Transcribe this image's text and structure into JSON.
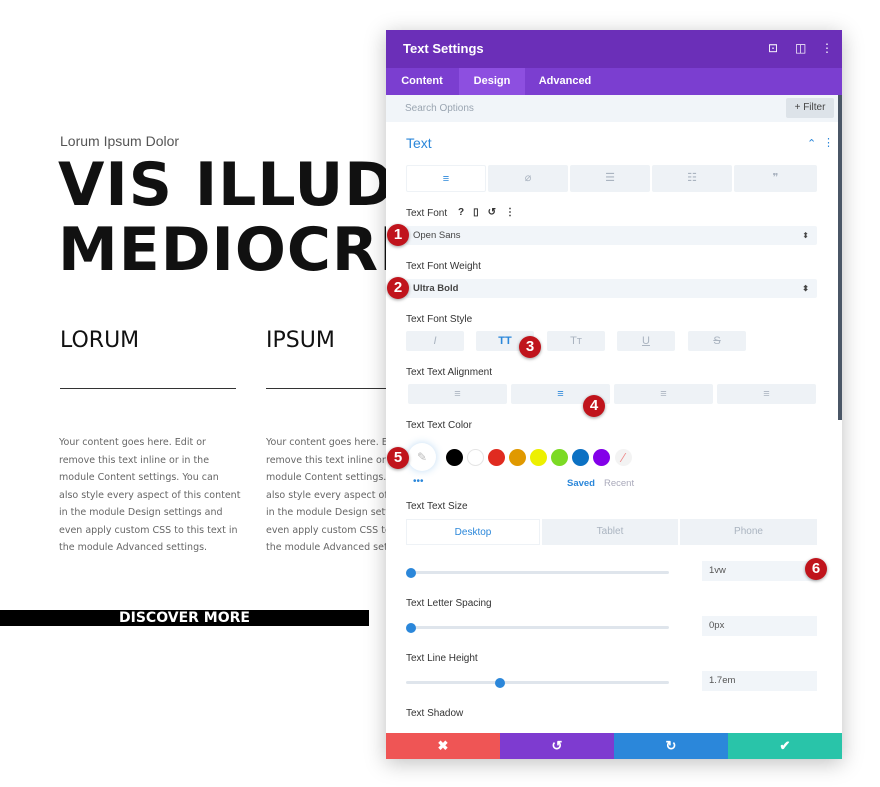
{
  "page": {
    "subtitle": "Lorum Ipsum Dolor",
    "heading_lines": [
      "VIS ILLUD EX",
      "MEDIOCRITA"
    ],
    "columns": [
      {
        "title": "LORUM",
        "body": "Your content goes here. Edit or remove this text inline or in the module Content settings. You can also style every aspect of this content in the module Design settings and even apply custom CSS to this text in the module Advanced settings."
      },
      {
        "title": "IPSUM",
        "body": "Your content goes here. Edit or remove this text inline or in the module Content settings. You can also style every aspect of this content in the module Design settings and even apply custom CSS to this text in the module Advanced settings."
      }
    ],
    "button": "DISCOVER MORE"
  },
  "panel": {
    "title": "Text Settings",
    "header_icons": [
      "focus-icon",
      "split-view-icon",
      "more-vertical-icon"
    ],
    "tabs": [
      "Content",
      "Design",
      "Advanced"
    ],
    "active_tab": "Design",
    "search_placeholder": "Search Options",
    "filter": "+ Filter",
    "section": "Text",
    "text_tabs": [
      "≡",
      "⌀",
      "☰",
      "☷",
      "❞"
    ],
    "font_label": "Text Font",
    "font_value": "Open Sans",
    "weight_label": "Text Font Weight",
    "weight_value": "Ultra Bold",
    "style_label": "Text Font Style",
    "style_buttons": [
      "I",
      "TT",
      "Tт",
      "U",
      "S"
    ],
    "style_active": "TT",
    "align_label": "Text Text Alignment",
    "align_active": "center",
    "color_label": "Text Text Color",
    "swatches": [
      "#000000",
      "#ffffff",
      "#e02b20",
      "#e09900",
      "#edf000",
      "#7cda24",
      "#0c71c3",
      "#8300e9"
    ],
    "saved": "Saved",
    "recent": "Recent",
    "size_label": "Text Text Size",
    "devices": [
      "Desktop",
      "Tablet",
      "Phone"
    ],
    "size_value": "1vw",
    "spacing_label": "Text Letter Spacing",
    "spacing_value": "0px",
    "line_height_label": "Text Line Height",
    "line_height_value": "1.7em",
    "shadow_label": "Text Shadow",
    "footer": {
      "cancel": "✖",
      "undo": "↺",
      "redo": "↻",
      "save": "✔"
    },
    "colors": {
      "header": "#6b2fb8",
      "tabs": "#7b3ed0",
      "accent": "#2b87da",
      "cancel": "#ef5555",
      "undo": "#7e3bd0",
      "redo": "#2b87da",
      "save": "#29c4a9"
    }
  },
  "markers": [
    "1",
    "2",
    "3",
    "4",
    "5",
    "6"
  ]
}
